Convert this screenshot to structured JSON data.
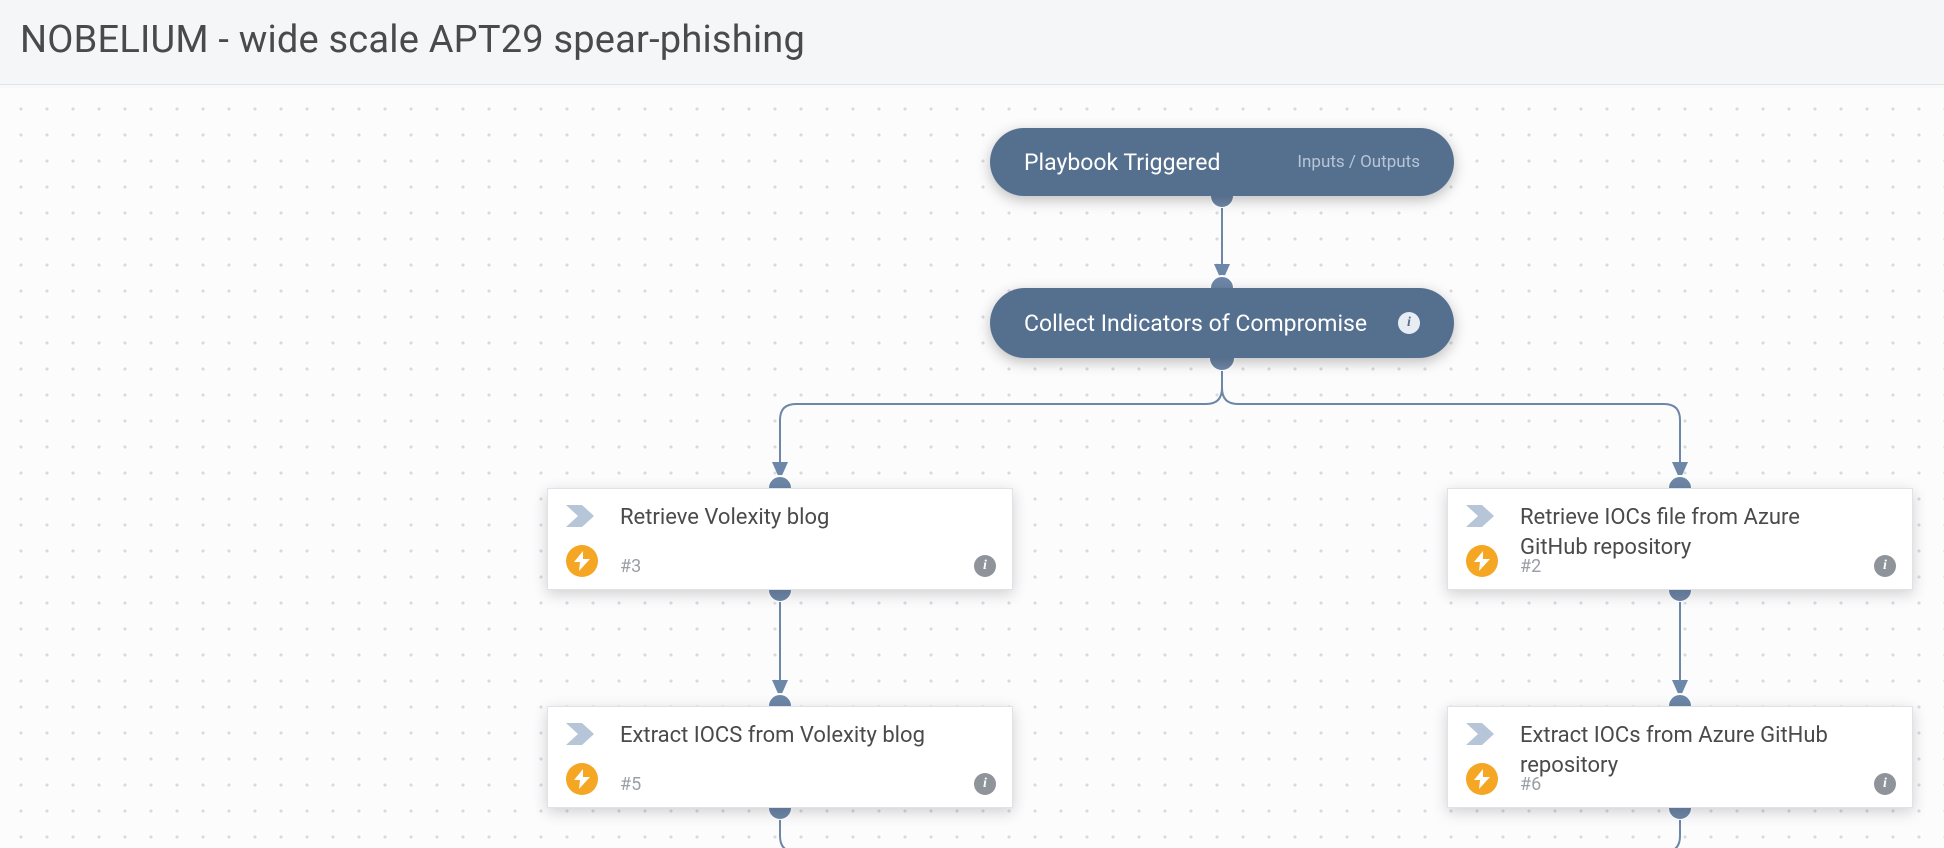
{
  "header": {
    "title": "NOBELIUM - wide scale APT29 spear-phishing"
  },
  "nodes": {
    "start": {
      "label": "Playbook Triggered",
      "subtext": "Inputs / Outputs"
    },
    "section": {
      "label": "Collect Indicators of Compromise"
    },
    "n3": {
      "label": "Retrieve Volexity blog",
      "idx": "#3"
    },
    "n2": {
      "label": "Retrieve IOCs file from Azure GitHub repository",
      "idx": "#2"
    },
    "n5": {
      "label": "Extract IOCS from Volexity blog",
      "idx": "#5"
    },
    "n6": {
      "label": "Extract IOCs from Azure GitHub repository",
      "idx": "#6"
    }
  },
  "icons": {
    "info": "i"
  }
}
